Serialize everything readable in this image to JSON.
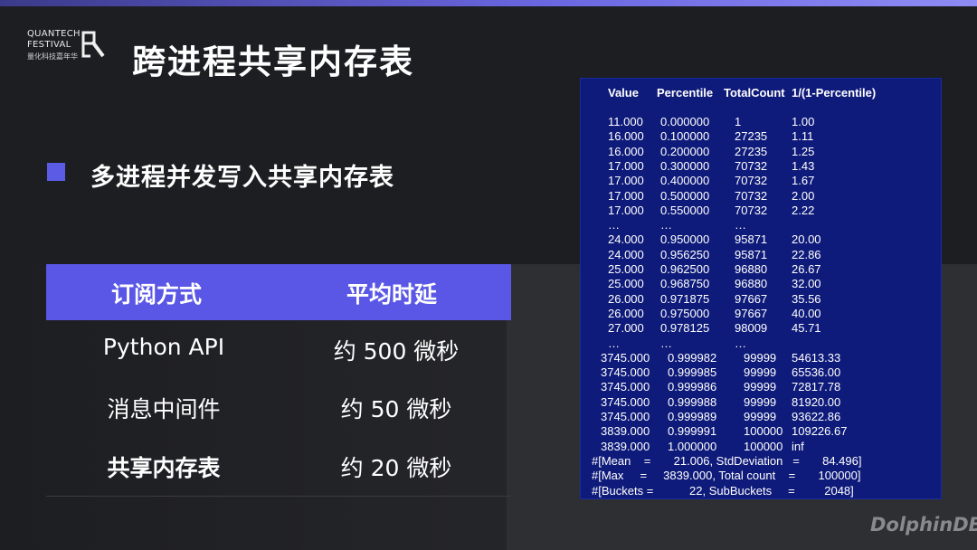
{
  "logo": {
    "line1": "QUANTECH",
    "line2": "FESTIVAL",
    "line3": "量化科技嘉年华"
  },
  "title": "跨进程共享内存表",
  "bullet": "多进程并发写入共享内存表",
  "table": {
    "headers": [
      "订阅方式",
      "平均时延"
    ],
    "rows": [
      {
        "method": "Python API",
        "latency": "约 500 微秒"
      },
      {
        "method": "消息中间件",
        "latency": "约 50 微秒"
      },
      {
        "method": "共享内存表",
        "latency": "约 20 微秒"
      }
    ]
  },
  "panel": {
    "headers": [
      "Value",
      "Percentile",
      "TotalCount",
      "1/(1-Percentile)"
    ],
    "block1": [
      [
        "11.000",
        "0.000000",
        "1",
        "1.00"
      ],
      [
        "16.000",
        "0.100000",
        "27235",
        "1.11"
      ],
      [
        "16.000",
        "0.200000",
        "27235",
        "1.25"
      ],
      [
        "17.000",
        "0.300000",
        "70732",
        "1.43"
      ],
      [
        "17.000",
        "0.400000",
        "70732",
        "1.67"
      ],
      [
        "17.000",
        "0.500000",
        "70732",
        "2.00"
      ],
      [
        "17.000",
        "0.550000",
        "70732",
        "2.22"
      ]
    ],
    "ellipsis": "…",
    "block2": [
      [
        "24.000",
        "0.950000",
        "95871",
        "20.00"
      ],
      [
        "24.000",
        "0.956250",
        "95871",
        "22.86"
      ],
      [
        "25.000",
        "0.962500",
        "96880",
        "26.67"
      ],
      [
        "25.000",
        "0.968750",
        "96880",
        "32.00"
      ],
      [
        "26.000",
        "0.971875",
        "97667",
        "35.56"
      ],
      [
        "26.000",
        "0.975000",
        "97667",
        "40.00"
      ],
      [
        "27.000",
        "0.978125",
        "98009",
        "45.71"
      ]
    ],
    "block3": [
      [
        "3745.000",
        "0.999982",
        "99999",
        "54613.33"
      ],
      [
        "3745.000",
        "0.999985",
        "99999",
        "65536.00"
      ],
      [
        "3745.000",
        "0.999986",
        "99999",
        "72817.78"
      ],
      [
        "3745.000",
        "0.999988",
        "99999",
        "81920.00"
      ],
      [
        "3745.000",
        "0.999989",
        "99999",
        "93622.86"
      ],
      [
        "3839.000",
        "0.999991",
        "100000",
        "109226.67"
      ],
      [
        "3839.000",
        "1.000000",
        "100000",
        "inf"
      ]
    ],
    "summary": [
      "#[Mean    =       21.006, StdDeviation   =       84.496]",
      "#[Max     =     3839.000, Total count    =       100000]",
      "#[Buckets =           22, SubBuckets     =         2048]"
    ]
  },
  "brand": "DolphinDB",
  "colors": {
    "accent": "#5a57e6",
    "panel": "#0f1b7a",
    "background": "#1d1e21"
  }
}
